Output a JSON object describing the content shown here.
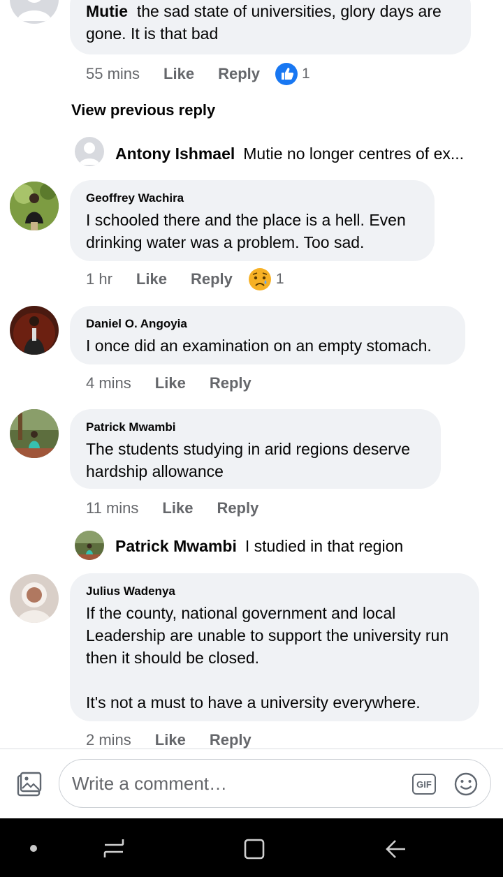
{
  "comments": [
    {
      "author": "Mutie",
      "text": "the sad state of universities, glory days are gone. It is that bad",
      "time": "55 mins",
      "like": "Like",
      "reply": "Reply",
      "reaction": "like",
      "count": "1"
    },
    {
      "author": "Geoffrey Wachira",
      "text": "I schooled there and the place is a hell. Even drinking water was a problem. Too sad.",
      "time": "1 hr",
      "like": "Like",
      "reply": "Reply",
      "reaction": "sad",
      "count": "1"
    },
    {
      "author": "Daniel O. Angoyia",
      "text": "I once did an examination on an empty stomach.",
      "time": "4 mins",
      "like": "Like",
      "reply": "Reply"
    },
    {
      "author": "Patrick Mwambi",
      "text": "The students studying in arid regions deserve hardship allowance",
      "time": "11 mins",
      "like": "Like",
      "reply": "Reply"
    },
    {
      "author": "Julius Wadenya",
      "text": "If the county, national government and local Leadership are unable to support the university run then it should be closed.\n\nIt's not a must to have a university everywhere.",
      "time": "2 mins",
      "like": "Like",
      "reply": "Reply"
    }
  ],
  "view_previous": "View previous reply",
  "replies": [
    {
      "author": "Antony Ishmael",
      "text": "Mutie no longer centres of ex..."
    },
    {
      "author": "Patrick Mwambi",
      "text": "I studied in that region"
    }
  ],
  "composer": {
    "placeholder": "Write a comment…",
    "gif": "GIF"
  },
  "colors": {
    "bubble": "#f0f2f5",
    "meta": "#65676b",
    "like_blue": "#1877f2",
    "navbar": "#000000"
  }
}
